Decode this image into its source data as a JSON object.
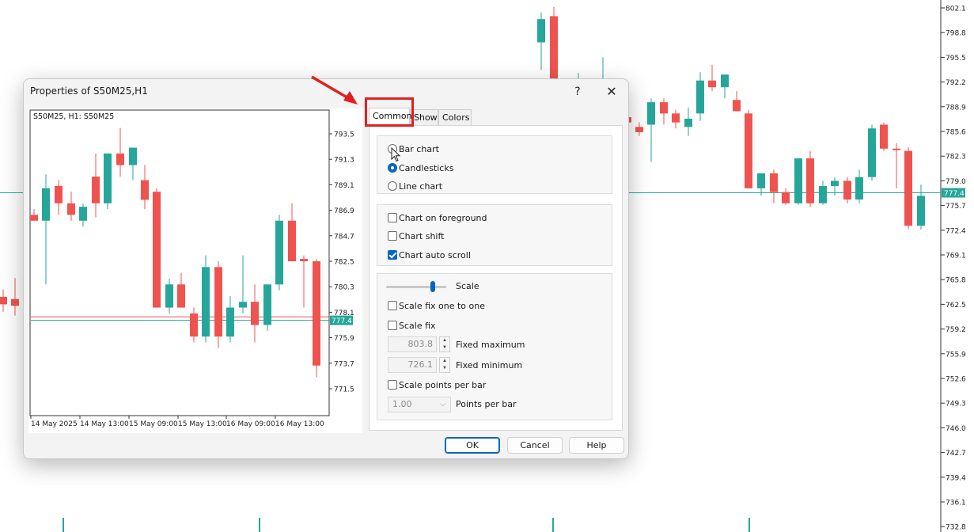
{
  "background_chart": {
    "price_axis_ticks": [
      "802.1",
      "798.8",
      "795.5",
      "792.2",
      "788.9",
      "785.6",
      "782.3",
      "779.0",
      "775.7",
      "772.4",
      "769.1",
      "765.8",
      "762.5",
      "759.2",
      "755.9",
      "752.6",
      "749.3",
      "746.0",
      "742.7",
      "739.4",
      "736.1",
      "732.8"
    ],
    "current_price": "777.4",
    "colors": {
      "up": "#26a69a",
      "down": "#ef5350",
      "price_line": "#26a69a"
    }
  },
  "dialog": {
    "title": "Properties of S50M25,H1",
    "help_label": "?",
    "close_label": "✕",
    "preview": {
      "label": "S50M25, H1:  S50M25",
      "y_ticks": [
        "793.5",
        "791.3",
        "789.1",
        "786.9",
        "784.7",
        "782.5",
        "780.3",
        "778.1",
        "775.9",
        "773.7",
        "771.5"
      ],
      "x_ticks": [
        "14 May 2025",
        "14 May 13:00",
        "15 May 09:00",
        "15 May 13:00",
        "16 May 09:00",
        "16 May 13:00"
      ],
      "current_price": "777.4"
    },
    "tabs": [
      {
        "label": "Common",
        "active": true
      },
      {
        "label": "Show",
        "active": false
      },
      {
        "label": "Colors",
        "active": false
      }
    ],
    "chart_type": {
      "bar_chart": "Bar chart",
      "candlesticks": "Candlesticks",
      "line_chart": "Line chart",
      "selected": "Candlesticks"
    },
    "display": {
      "chart_on_foreground": {
        "label": "Chart on foreground",
        "checked": false
      },
      "chart_shift": {
        "label": "Chart shift",
        "checked": false
      },
      "chart_auto_scroll": {
        "label": "Chart auto scroll",
        "checked": true
      }
    },
    "scale": {
      "slider_label": "Scale",
      "slider_level": 0.8,
      "scale_fix_one_to_one": {
        "label": "Scale fix one to one",
        "checked": false
      },
      "scale_fix": {
        "label": "Scale fix",
        "checked": false
      },
      "fixed_maximum_value": "803.8",
      "fixed_maximum_label": "Fixed maximum",
      "fixed_minimum_value": "726.1",
      "fixed_minimum_label": "Fixed minimum",
      "scale_points_per_bar": {
        "label": "Scale points per bar",
        "checked": false
      },
      "points_per_bar_value": "1.00",
      "points_per_bar_label": "Points per bar"
    },
    "buttons": {
      "ok": "OK",
      "cancel": "Cancel",
      "help": "Help"
    }
  }
}
